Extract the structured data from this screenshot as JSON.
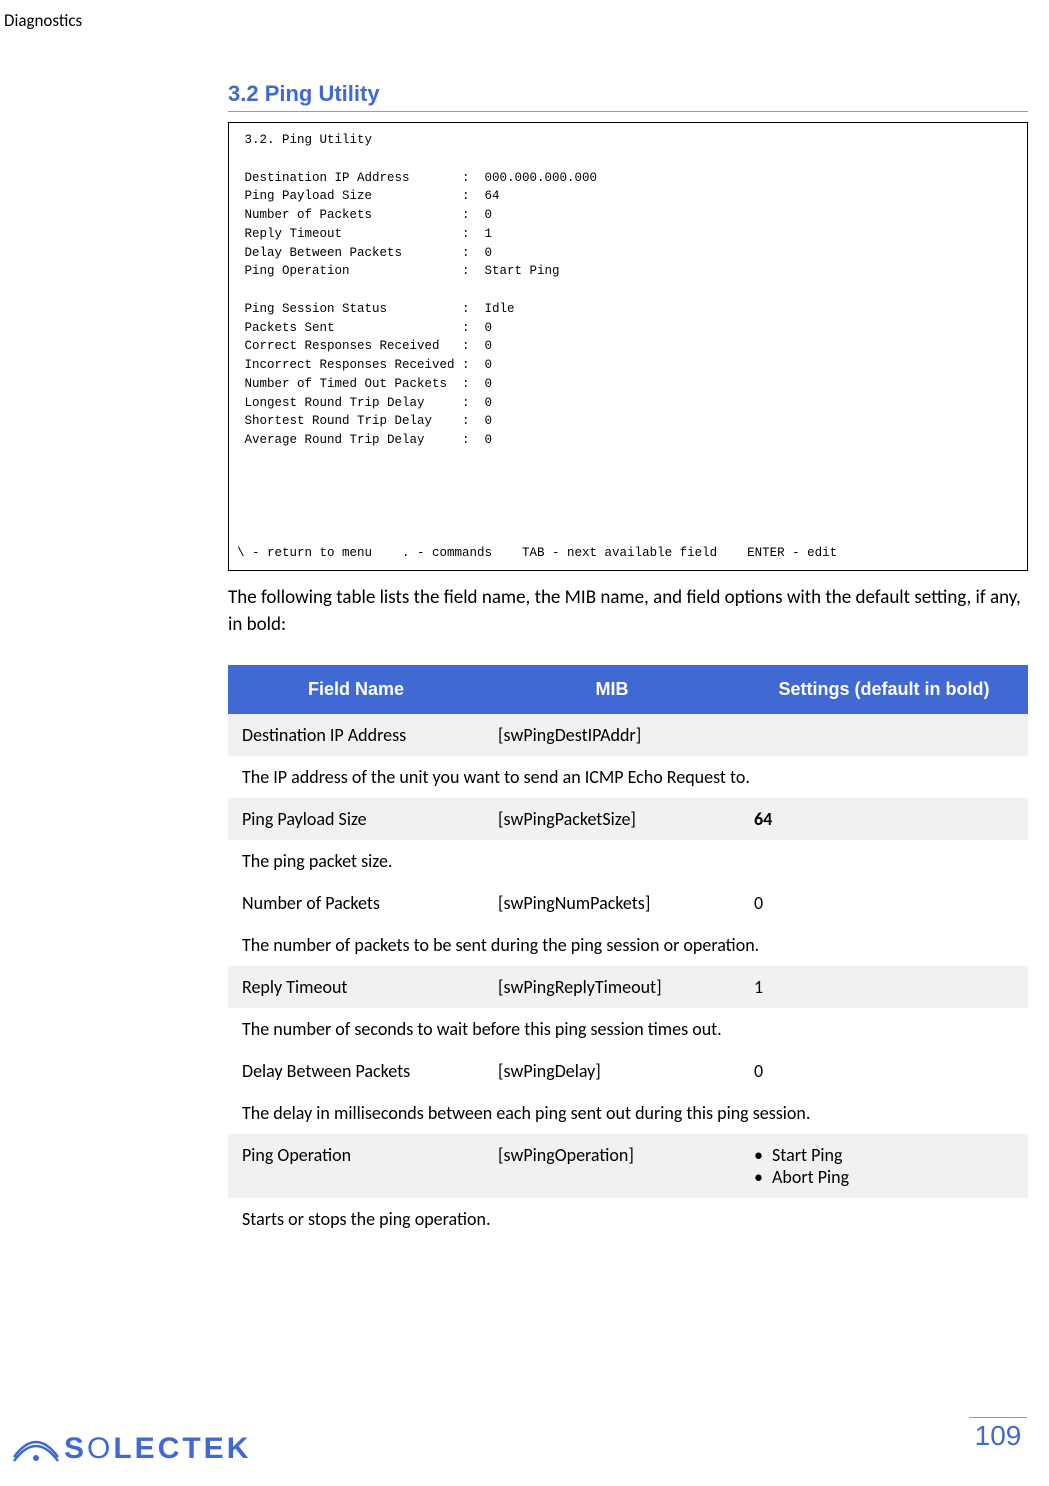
{
  "header": {
    "label": "Diagnostics"
  },
  "section": {
    "title": "3.2 Ping Utility"
  },
  "terminal": {
    "title": "3.2. Ping Utility",
    "rows": [
      {
        "label": "Destination IP Address",
        "value": "000.000.000.000"
      },
      {
        "label": "Ping Payload Size",
        "value": "64"
      },
      {
        "label": "Number of Packets",
        "value": "0"
      },
      {
        "label": "Reply Timeout",
        "value": "1"
      },
      {
        "label": "Delay Between Packets",
        "value": "0"
      },
      {
        "label": "Ping Operation",
        "value": "Start Ping"
      }
    ],
    "rows2": [
      {
        "label": "Ping Session Status",
        "value": "Idle"
      },
      {
        "label": "Packets Sent",
        "value": "0"
      },
      {
        "label": "Correct Responses Received",
        "value": "0"
      },
      {
        "label": "Incorrect Responses Received",
        "value": "0"
      },
      {
        "label": "Number of Timed Out Packets",
        "value": "0"
      },
      {
        "label": "Longest Round Trip Delay",
        "value": "0"
      },
      {
        "label": "Shortest Round Trip Delay",
        "value": "0"
      },
      {
        "label": "Average Round Trip Delay",
        "value": "0"
      }
    ],
    "footer": "\\ - return to menu    . - commands    TAB - next available field    ENTER - edit"
  },
  "intro": "The following table lists the field name, the MIB name, and field options with the default setting, if any, in bold:",
  "table": {
    "headers": {
      "c1": "Field Name",
      "c2": "MIB",
      "c3": "Settings (default in bold)"
    },
    "rows": [
      {
        "shade": true,
        "field": "Destination IP Address",
        "mib": "[swPingDestIPAddr]",
        "settings": ""
      },
      {
        "desc": true,
        "text": "The IP address of the unit you want to send an ICMP Echo Request to."
      },
      {
        "shade": true,
        "field": "Ping Payload Size",
        "mib": "[swPingPacketSize]",
        "settings": "64",
        "bold": true
      },
      {
        "desc": true,
        "text": "The ping packet size."
      },
      {
        "shade": false,
        "field": "Number of Packets",
        "mib": "[swPingNumPackets]",
        "settings": "0"
      },
      {
        "desc": true,
        "text": "The number of packets to be sent during the ping session or operation."
      },
      {
        "shade": true,
        "field": "Reply Timeout",
        "mib": "[swPingReplyTimeout]",
        "settings": "1"
      },
      {
        "desc": true,
        "text": "The number of seconds to wait before this ping session times out."
      },
      {
        "shade": false,
        "field": "Delay Between Packets",
        "mib": "[swPingDelay]",
        "settings": "0"
      },
      {
        "desc": true,
        "text": "The delay in milliseconds between each ping sent out during this ping session."
      },
      {
        "shade": true,
        "field": "Ping Operation",
        "mib": "[swPingOperation]",
        "settings_list": [
          "Start Ping",
          "Abort Ping"
        ]
      },
      {
        "desc": true,
        "text": "Starts or stops the ping operation."
      }
    ]
  },
  "footer": {
    "logo": {
      "brand_pre": "S",
      "brand_o": "O",
      "brand_rest": "LECTEK"
    },
    "page": "109"
  }
}
